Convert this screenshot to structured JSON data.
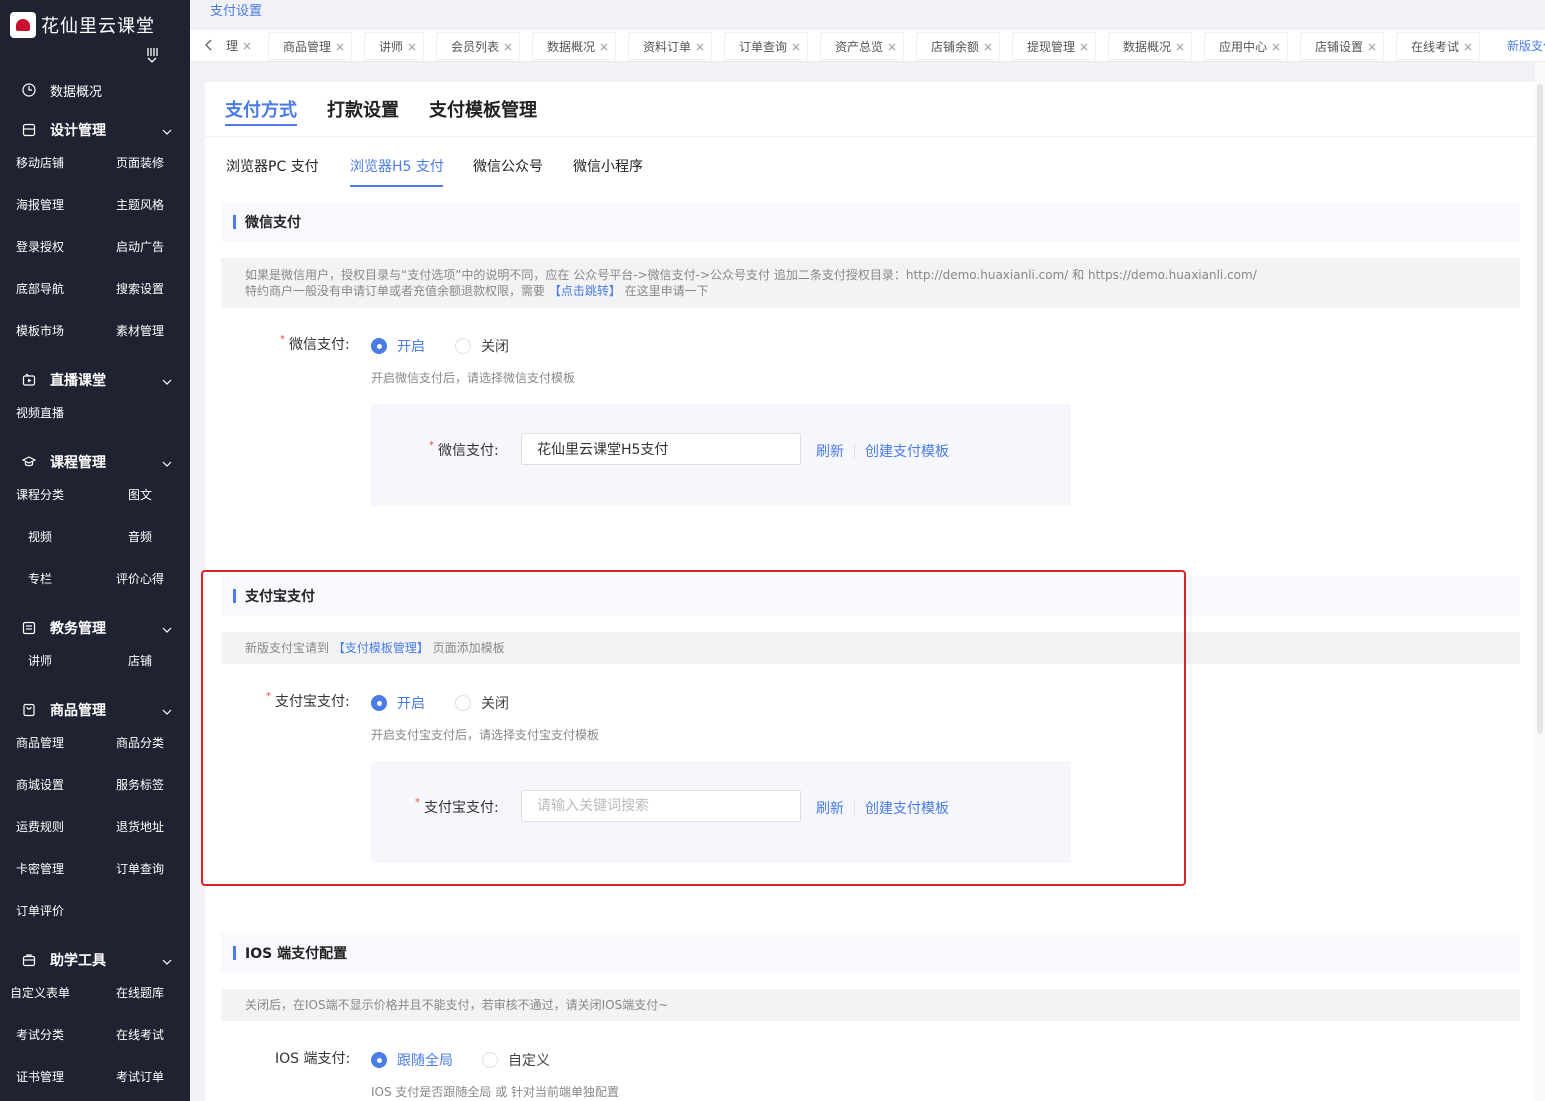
{
  "app": {
    "title": "花仙里云课堂"
  },
  "sidebar": {
    "top_item": "数据概况",
    "groups": [
      {
        "label": "设计管理",
        "items": [
          "移动店铺",
          "页面装修",
          "海报管理",
          "主题风格",
          "登录授权",
          "启动广告",
          "底部导航",
          "搜索设置",
          "模板市场",
          "素材管理"
        ]
      },
      {
        "label": "直播课堂",
        "items": [
          "视频直播"
        ]
      },
      {
        "label": "课程管理",
        "items": [
          "课程分类",
          "图文",
          "视频",
          "音频",
          "专栏",
          "评价心得"
        ]
      },
      {
        "label": "教务管理",
        "items": [
          "讲师",
          "店铺"
        ]
      },
      {
        "label": "商品管理",
        "items": [
          "商品管理",
          "商品分类",
          "商城设置",
          "服务标签",
          "运费规则",
          "退货地址",
          "卡密管理",
          "订单查询",
          "订单评价"
        ]
      },
      {
        "label": "助学工具",
        "items": [
          "自定义表单",
          "在线题库",
          "考试分类",
          "在线考试",
          "证书管理",
          "考试订单"
        ]
      }
    ]
  },
  "breadcrumb": "支付设置",
  "page_tabs": {
    "partial": "理",
    "items": [
      "商品管理",
      "讲师",
      "会员列表",
      "数据概况",
      "资料订单",
      "订单查询",
      "资产总览",
      "店铺余额",
      "提现管理",
      "数据概况",
      "应用中心",
      "店铺设置",
      "在线考试"
    ],
    "active": "新版支付设置",
    "close": "×"
  },
  "main_tabs": [
    "支付方式",
    "打款设置",
    "支付模板管理"
  ],
  "sub_tabs": [
    "浏览器PC 支付",
    "浏览器H5 支付",
    "微信公众号",
    "微信小程序"
  ],
  "wechat": {
    "title": "微信支付",
    "notice_line1": "如果是微信用户，授权目录与“支付选项”中的说明不同，应在 公众号平台->微信支付->公众号支付 追加二条支付授权目录：http://demo.huaxianli.com/ 和 https://demo.huaxianli.com/",
    "notice_line2_pre": "特约商户一般没有申请订单或者充值余额退款权限，需要 ",
    "notice_line2_link": "【点击跳转】",
    "notice_line2_post": " 在这里申请一下",
    "label": "微信支付:",
    "on": "开启",
    "off": "关闭",
    "hint": "开启微信支付后，请选择微信支付模板",
    "tpl_label": "微信支付:",
    "tpl_value": "花仙里云课堂H5支付",
    "refresh": "刷新",
    "create": "创建支付模板"
  },
  "alipay": {
    "title": "支付宝支付",
    "notice_pre": "新版支付宝请到 ",
    "notice_link": "【支付模板管理】",
    "notice_post": " 页面添加模板",
    "label": "支付宝支付:",
    "on": "开启",
    "off": "关闭",
    "hint": "开启支付宝支付后，请选择支付宝支付模板",
    "tpl_label": "支付宝支付:",
    "tpl_placeholder": "请输入关键词搜索",
    "refresh": "刷新",
    "create": "创建支付模板"
  },
  "ios": {
    "title": "IOS 端支付配置",
    "notice": "关闭后，在IOS端不显示价格并且不能支付，若审核不通过，请关闭IOS端支付~",
    "label": "IOS 端支付:",
    "opt1": "跟随全局",
    "opt2": "自定义",
    "hint": "IOS 支付是否跟随全局 或 针对当前端单独配置"
  },
  "colors": {
    "accent": "#4a7be6",
    "sidebar_bg": "#1f2231",
    "highlight": "#d9262c",
    "required": "#e74c3c"
  }
}
